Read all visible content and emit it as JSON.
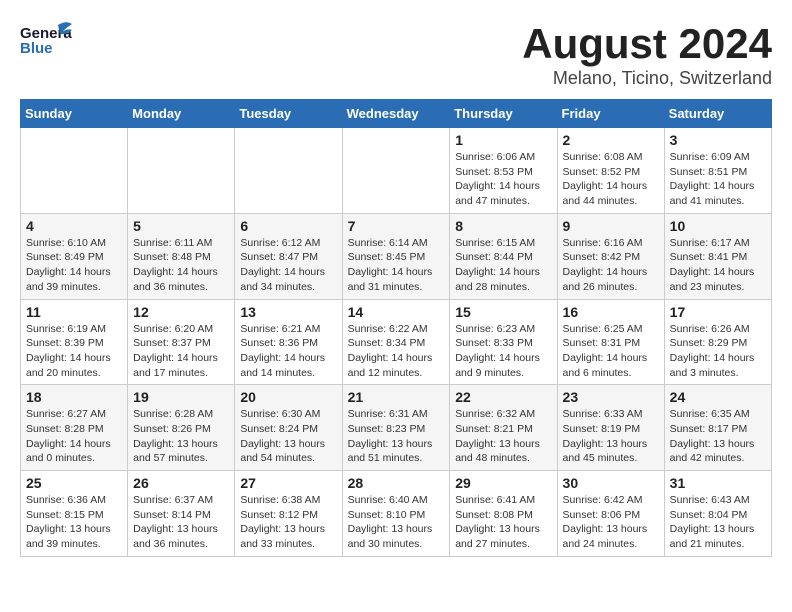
{
  "header": {
    "logo_general": "General",
    "logo_blue": "Blue",
    "title": "August 2024",
    "subtitle": "Melano, Ticino, Switzerland"
  },
  "days_of_week": [
    "Sunday",
    "Monday",
    "Tuesday",
    "Wednesday",
    "Thursday",
    "Friday",
    "Saturday"
  ],
  "weeks": [
    [
      {
        "day": "",
        "info": ""
      },
      {
        "day": "",
        "info": ""
      },
      {
        "day": "",
        "info": ""
      },
      {
        "day": "",
        "info": ""
      },
      {
        "day": "1",
        "info": "Sunrise: 6:06 AM\nSunset: 8:53 PM\nDaylight: 14 hours\nand 47 minutes."
      },
      {
        "day": "2",
        "info": "Sunrise: 6:08 AM\nSunset: 8:52 PM\nDaylight: 14 hours\nand 44 minutes."
      },
      {
        "day": "3",
        "info": "Sunrise: 6:09 AM\nSunset: 8:51 PM\nDaylight: 14 hours\nand 41 minutes."
      }
    ],
    [
      {
        "day": "4",
        "info": "Sunrise: 6:10 AM\nSunset: 8:49 PM\nDaylight: 14 hours\nand 39 minutes."
      },
      {
        "day": "5",
        "info": "Sunrise: 6:11 AM\nSunset: 8:48 PM\nDaylight: 14 hours\nand 36 minutes."
      },
      {
        "day": "6",
        "info": "Sunrise: 6:12 AM\nSunset: 8:47 PM\nDaylight: 14 hours\nand 34 minutes."
      },
      {
        "day": "7",
        "info": "Sunrise: 6:14 AM\nSunset: 8:45 PM\nDaylight: 14 hours\nand 31 minutes."
      },
      {
        "day": "8",
        "info": "Sunrise: 6:15 AM\nSunset: 8:44 PM\nDaylight: 14 hours\nand 28 minutes."
      },
      {
        "day": "9",
        "info": "Sunrise: 6:16 AM\nSunset: 8:42 PM\nDaylight: 14 hours\nand 26 minutes."
      },
      {
        "day": "10",
        "info": "Sunrise: 6:17 AM\nSunset: 8:41 PM\nDaylight: 14 hours\nand 23 minutes."
      }
    ],
    [
      {
        "day": "11",
        "info": "Sunrise: 6:19 AM\nSunset: 8:39 PM\nDaylight: 14 hours\nand 20 minutes."
      },
      {
        "day": "12",
        "info": "Sunrise: 6:20 AM\nSunset: 8:37 PM\nDaylight: 14 hours\nand 17 minutes."
      },
      {
        "day": "13",
        "info": "Sunrise: 6:21 AM\nSunset: 8:36 PM\nDaylight: 14 hours\nand 14 minutes."
      },
      {
        "day": "14",
        "info": "Sunrise: 6:22 AM\nSunset: 8:34 PM\nDaylight: 14 hours\nand 12 minutes."
      },
      {
        "day": "15",
        "info": "Sunrise: 6:23 AM\nSunset: 8:33 PM\nDaylight: 14 hours\nand 9 minutes."
      },
      {
        "day": "16",
        "info": "Sunrise: 6:25 AM\nSunset: 8:31 PM\nDaylight: 14 hours\nand 6 minutes."
      },
      {
        "day": "17",
        "info": "Sunrise: 6:26 AM\nSunset: 8:29 PM\nDaylight: 14 hours\nand 3 minutes."
      }
    ],
    [
      {
        "day": "18",
        "info": "Sunrise: 6:27 AM\nSunset: 8:28 PM\nDaylight: 14 hours\nand 0 minutes."
      },
      {
        "day": "19",
        "info": "Sunrise: 6:28 AM\nSunset: 8:26 PM\nDaylight: 13 hours\nand 57 minutes."
      },
      {
        "day": "20",
        "info": "Sunrise: 6:30 AM\nSunset: 8:24 PM\nDaylight: 13 hours\nand 54 minutes."
      },
      {
        "day": "21",
        "info": "Sunrise: 6:31 AM\nSunset: 8:23 PM\nDaylight: 13 hours\nand 51 minutes."
      },
      {
        "day": "22",
        "info": "Sunrise: 6:32 AM\nSunset: 8:21 PM\nDaylight: 13 hours\nand 48 minutes."
      },
      {
        "day": "23",
        "info": "Sunrise: 6:33 AM\nSunset: 8:19 PM\nDaylight: 13 hours\nand 45 minutes."
      },
      {
        "day": "24",
        "info": "Sunrise: 6:35 AM\nSunset: 8:17 PM\nDaylight: 13 hours\nand 42 minutes."
      }
    ],
    [
      {
        "day": "25",
        "info": "Sunrise: 6:36 AM\nSunset: 8:15 PM\nDaylight: 13 hours\nand 39 minutes."
      },
      {
        "day": "26",
        "info": "Sunrise: 6:37 AM\nSunset: 8:14 PM\nDaylight: 13 hours\nand 36 minutes."
      },
      {
        "day": "27",
        "info": "Sunrise: 6:38 AM\nSunset: 8:12 PM\nDaylight: 13 hours\nand 33 minutes."
      },
      {
        "day": "28",
        "info": "Sunrise: 6:40 AM\nSunset: 8:10 PM\nDaylight: 13 hours\nand 30 minutes."
      },
      {
        "day": "29",
        "info": "Sunrise: 6:41 AM\nSunset: 8:08 PM\nDaylight: 13 hours\nand 27 minutes."
      },
      {
        "day": "30",
        "info": "Sunrise: 6:42 AM\nSunset: 8:06 PM\nDaylight: 13 hours\nand 24 minutes."
      },
      {
        "day": "31",
        "info": "Sunrise: 6:43 AM\nSunset: 8:04 PM\nDaylight: 13 hours\nand 21 minutes."
      }
    ]
  ]
}
